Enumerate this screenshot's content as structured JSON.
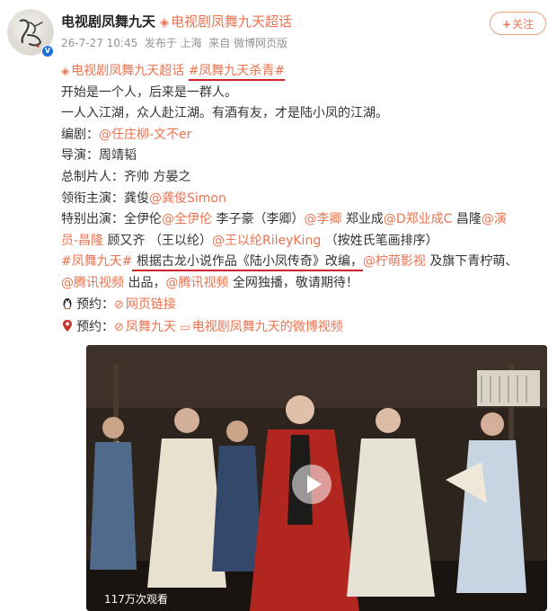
{
  "user": {
    "name": "电视剧凤舞九天",
    "super_topic": "电视剧凤舞九天超话",
    "meta": "26-7-27 10:45  发布于 上海  来自 微博网页版",
    "follow_label": "关注"
  },
  "post": {
    "line1": {
      "topic1": "电视剧凤舞九天超话",
      "topic2": "#凤舞九天杀青#"
    },
    "line2": "开始是一个人，后来是一群人。",
    "line3": "一人入江湖，众人赴江湖。有酒有友，才是陆小凤的江湖。",
    "screenwriter": {
      "label": "编剧：",
      "mention": "@任庄柳-文不er"
    },
    "director": {
      "label": "导演：",
      "name": "周靖韬"
    },
    "producer": {
      "label": "总制片人：",
      "names": "齐帅 方晏之"
    },
    "lead": {
      "label": "领衔主演：",
      "name": "龚俊",
      "mention": "@龚俊Simon"
    },
    "special": {
      "label": "特别出演：",
      "a1": "全伊伦",
      "m1": "@全伊伦",
      "a2": " 李子豪（李卿）",
      "m2": "@李卿",
      "a3": " 郑业成",
      "m3": "@D郑业成C",
      "a4": " 昌隆",
      "m4a": "@演",
      "m4b": "员-昌隆",
      "a5": " 顾又齐 （王以纶）",
      "m5": "@王以纶RileyKing",
      "note": " （按姓氏笔画排序）"
    },
    "adapt": {
      "topic": "#凤舞九天#",
      "text": " 根据古龙小说作品《陆小凤传奇》改编，",
      "mention": "@柠萌影视",
      "tail": " 及旗下青柠萌、"
    },
    "produce": {
      "mention1": "@腾讯视频",
      "text1": " 出品，",
      "mention2": "@腾讯视频",
      "text2": " 全网独播，敬请期待！"
    },
    "reserve1": {
      "label": "预约：",
      "link": "网页链接"
    },
    "reserve2": {
      "label": "预约：",
      "link1": "凤舞九天",
      "link2": "电视剧凤舞九天的微博视频"
    }
  },
  "video": {
    "views": "117万次观看"
  },
  "colors": {
    "accent": "#eb7350",
    "underline": "#d0202a",
    "verified": "#1e6fd9"
  },
  "icons": [
    "avatar",
    "verified-icon",
    "super-topic-icon",
    "plus-icon",
    "link-icon",
    "location-pin-icon",
    "video-icon",
    "play-icon"
  ]
}
